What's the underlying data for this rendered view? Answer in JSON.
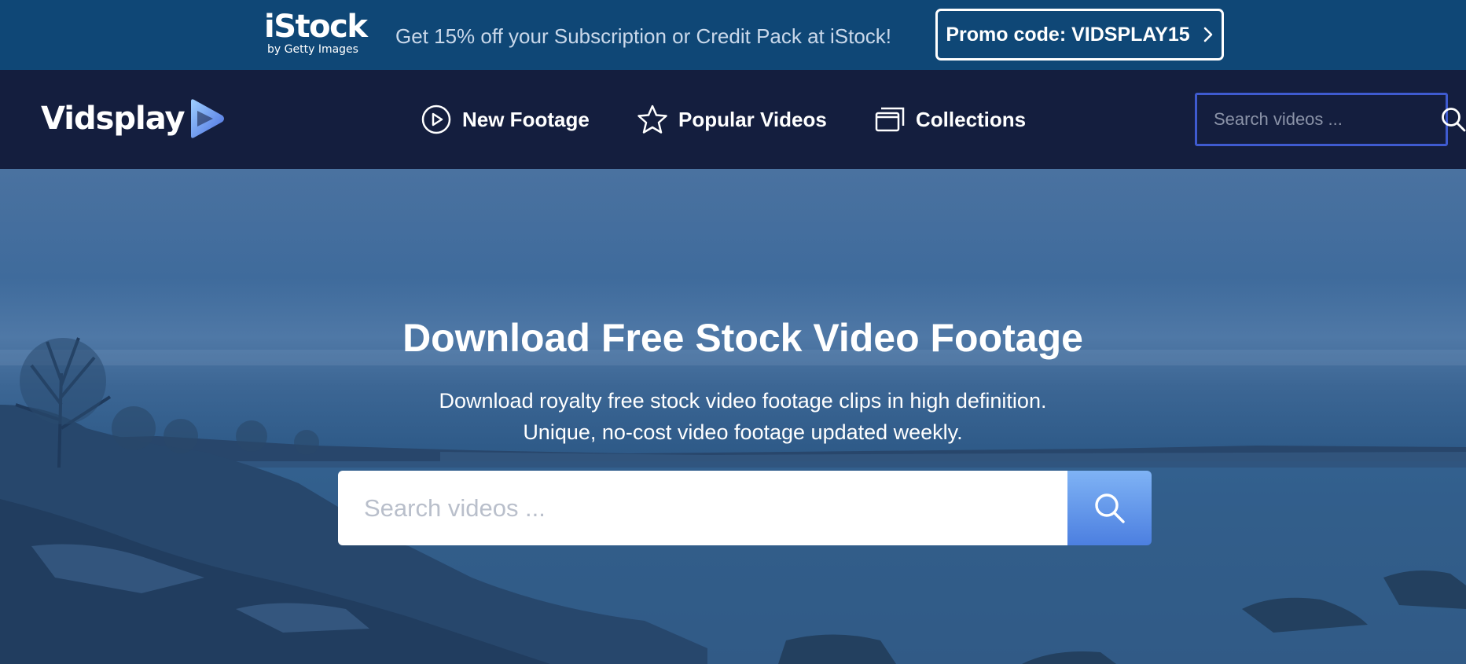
{
  "promo": {
    "brand": "iStock",
    "brand_sub": "by Getty Images",
    "text": "Get 15% off your Subscription or Credit Pack at iStock!",
    "code_label": "Promo code: VIDSPLAY15",
    "code_icon": "chevron-right-icon"
  },
  "nav": {
    "logo_text": "Vidsplay",
    "logo_icon": "play-triangle-icon",
    "items": [
      {
        "label": "New Footage",
        "icon": "play-circle-icon"
      },
      {
        "label": "Popular Videos",
        "icon": "star-icon"
      },
      {
        "label": "Collections",
        "icon": "collections-icon"
      }
    ],
    "search_placeholder": "Search videos ...",
    "search_icon": "search-icon"
  },
  "hero": {
    "title": "Download Free Stock Video Footage",
    "subtitle_line1": "Download royalty free stock video footage clips in high definition.",
    "subtitle_line2": "Unique, no-cost video footage updated weekly.",
    "search_placeholder": "Search videos ...",
    "search_icon": "search-icon"
  },
  "colors": {
    "promo_bg": "#0f4776",
    "nav_bg": "#141e3e",
    "search_border": "#3f5bd0",
    "hero_button_top": "#7fb3f5",
    "hero_button_bottom": "#4c7fe0"
  }
}
